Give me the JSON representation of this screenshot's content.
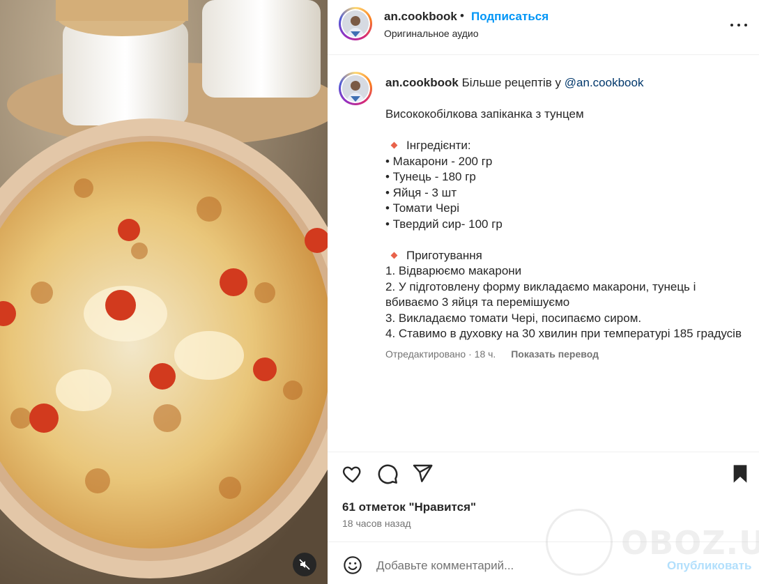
{
  "post": {
    "username": "an.cookbook",
    "separator": "•",
    "follow_label": "Подписаться",
    "audio_label": "Оригинальное аудио",
    "more_icon": "more-horizontal-icon"
  },
  "caption": {
    "username": "an.cookbook",
    "intro": "Більше рецептів у",
    "mention": "@an.cookbook",
    "title": "Висококобілкова запіканка з тунцем",
    "ingredients_heading": "Інгредієнти:",
    "ingredients": [
      "• Макарони - 200 гр",
      "• Тунець - 180 гр",
      "• Яйця - 3 шт",
      "• Томати Чері",
      "• Твердий сир- 100 гр"
    ],
    "steps_heading": "Приготування",
    "steps": [
      "1. Відварюємо макарони",
      "2. У підготовлену форму викладаємо макарони, тунець і",
      "вбиваємо 3 яйця та перемішуємо",
      "3. Викладаємо томати Чері, посипаємо сиром.",
      "4. Ставимо в духовку на 30 хвилин при температурі 185 градусів"
    ],
    "edited_label": "Отредактировано",
    "time_separator": " · ",
    "time_short": "18 ч.",
    "translate_label": "Показать перевод"
  },
  "actions": {
    "like_icon": "heart-icon",
    "comment_icon": "comment-icon",
    "share_icon": "send-icon",
    "save_icon": "bookmark-icon"
  },
  "likes_text": "61 отметок \"Нравится\"",
  "time_ago": "18 часов назад",
  "comment": {
    "placeholder": "Добавьте комментарий...",
    "post_label": "Опубликовать",
    "emoji_icon": "smiley-icon"
  },
  "watermark": {
    "text": "OBOZ.UA"
  },
  "media": {
    "mute_icon": "muted-speaker-icon"
  },
  "colors": {
    "accent_blue": "#0095f6",
    "post_button_disabled": "#b2dffc",
    "text_primary": "#262626",
    "text_secondary": "#737373",
    "mention": "#00376b",
    "diamond": "#e8624a"
  }
}
